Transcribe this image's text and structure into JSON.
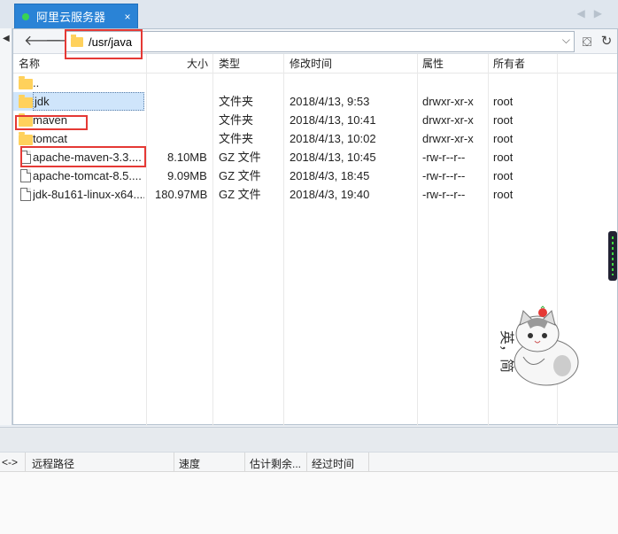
{
  "tab": {
    "title": "阿里云服务器",
    "close_label": "×"
  },
  "toolbar": {
    "path": "/usr/java"
  },
  "columns": {
    "name": "名称",
    "size": "大小",
    "type": "类型",
    "modified": "修改时间",
    "attrs": "属性",
    "owner": "所有者"
  },
  "files": [
    {
      "name": "..",
      "size": "",
      "type": "",
      "modified": "",
      "attrs": "",
      "owner": "",
      "icon": "folder-icon"
    },
    {
      "name": "jdk",
      "size": "",
      "type": "文件夹",
      "modified": "2018/4/13, 9:53",
      "attrs": "drwxr-xr-x",
      "owner": "root",
      "icon": "folder-icon",
      "selected": true
    },
    {
      "name": "maven",
      "size": "",
      "type": "文件夹",
      "modified": "2018/4/13, 10:41",
      "attrs": "drwxr-xr-x",
      "owner": "root",
      "icon": "folder-icon"
    },
    {
      "name": "tomcat",
      "size": "",
      "type": "文件夹",
      "modified": "2018/4/13, 10:02",
      "attrs": "drwxr-xr-x",
      "owner": "root",
      "icon": "folder-icon"
    },
    {
      "name": "apache-maven-3.3....",
      "size": "8.10MB",
      "type": "GZ 文件",
      "modified": "2018/4/13, 10:45",
      "attrs": "-rw-r--r--",
      "owner": "root",
      "icon": "file-icon"
    },
    {
      "name": "apache-tomcat-8.5....",
      "size": "9.09MB",
      "type": "GZ 文件",
      "modified": "2018/4/3, 18:45",
      "attrs": "-rw-r--r--",
      "owner": "root",
      "icon": "file-icon"
    },
    {
      "name": "jdk-8u161-linux-x64....",
      "size": "180.97MB",
      "type": "GZ 文件",
      "modified": "2018/4/3, 19:40",
      "attrs": "-rw-r--r--",
      "owner": "root",
      "icon": "file-icon"
    }
  ],
  "transfer": {
    "direction": "<->",
    "remote_path": "远程路径",
    "speed": "速度",
    "eta": "估计剩余...",
    "elapsed": "经过时间"
  },
  "sticker": {
    "text": "英，简"
  },
  "colors": {
    "tab_active": "#2a83d6",
    "selection": "#cfe5fb",
    "highlight_box": "#e53935",
    "folder": "#ffd15c"
  }
}
